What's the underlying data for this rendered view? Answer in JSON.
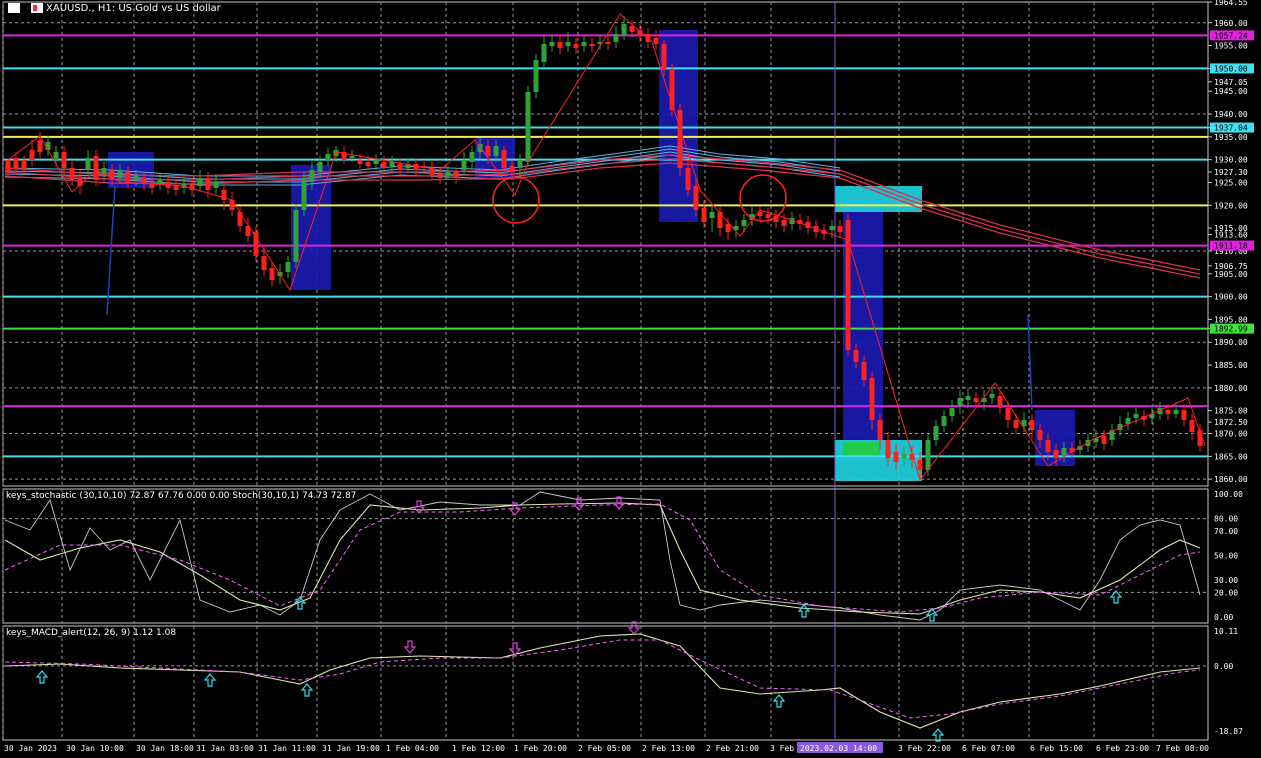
{
  "window": {
    "symbol": "XAUUSD.",
    "timeframe": "H1",
    "description": "US Gold vs US dollar",
    "title": "XAUUSD., H1:  US Gold vs US dollar"
  },
  "colors": {
    "background": "#000000",
    "grid": "#c0c0c0",
    "bull_candle": "#2fa33a",
    "bear_candle": "#ff2020",
    "ma_blue": "#5ab4e6",
    "ma_red": "#d8304f",
    "zone_blue": "#1a1ab0",
    "zone_cyan": "#20d0e0",
    "line_cyan": "#40e0f0",
    "line_yellow": "#f0f050",
    "line_magenta": "#e020e0",
    "line_green": "#40e040",
    "zigzag": "#ff2020",
    "stoch_main": "#dde8b0",
    "stoch_signal": "#ff60ff",
    "stoch_raw": "#c8c8c8",
    "arrow_up": "#30e0f0",
    "arrow_down": "#e040e0"
  },
  "price_axis": {
    "labels": [
      "1964.55",
      "1960.00",
      "1955.00",
      "1950.00",
      "1947.05",
      "1945.00",
      "1940.00",
      "1937.04",
      "1935.00",
      "1930.00",
      "1927.30",
      "1925.00",
      "1920.00",
      "1915.00",
      "1913.60",
      "1910.00",
      "1906.75",
      "1905.00",
      "1900.00",
      "1895.00",
      "1892.99",
      "1890.00",
      "1885.00",
      "1880.00",
      "1875.00",
      "1872.50",
      "1870.00",
      "1865.00",
      "1860.00"
    ],
    "highlighted": [
      {
        "value": "1957.24",
        "color": "#e020e0"
      },
      {
        "value": "1950.00",
        "color": "#40e0f0"
      },
      {
        "value": "1937.04",
        "color": "#40e0f0"
      },
      {
        "value": "1911.18",
        "color": "#e020e0"
      },
      {
        "value": "1892.99",
        "color": "#40e040"
      }
    ]
  },
  "time_axis": {
    "labels": [
      "30 Jan 2023",
      "30 Jan 10:00",
      "30 Jan 18:00",
      "31 Jan 03:00",
      "31 Jan 11:00",
      "31 Jan 19:00",
      "1 Feb 04:00",
      "1 Feb 12:00",
      "1 Feb 20:00",
      "2 Feb 05:00",
      "2 Feb 13:00",
      "2 Feb 21:00",
      "3 Feb",
      "3 Feb 22:00",
      "6 Feb 07:00",
      "6 Feb 15:00",
      "6 Feb 23:00",
      "7 Feb 08:00"
    ],
    "cursor_label": "2023.02.03 14:00"
  },
  "stochastic": {
    "title": "keys_stochastic (30,10,10) 72.87 67.76 0.00 0.00 Stoch(30,10,1) 74.73 72.87",
    "levels": [
      "100.00",
      "80.00",
      "70.00",
      "50.00",
      "30.00",
      "20.00",
      "0.00"
    ]
  },
  "macd": {
    "title": "keys_MACD_alert(12, 26, 9) 1.12 1.08",
    "levels": [
      "10.11",
      "0.00",
      "-18.87"
    ]
  }
}
